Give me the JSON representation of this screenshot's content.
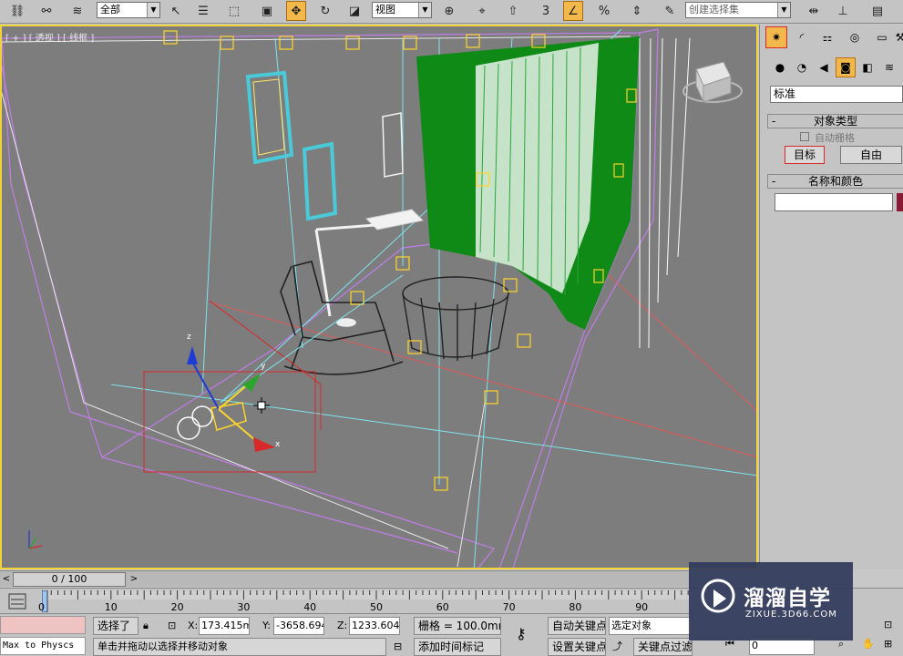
{
  "toolbar": {
    "selection_filter": "全部",
    "reference_coord": "视图",
    "named_selection": "创建选择集",
    "snap_value": "3"
  },
  "viewport": {
    "label": "[ + ] [ 透视 ] [ 线框 ]"
  },
  "command_panel": {
    "category_dropdown": "标准",
    "object_type_title": "对象类型",
    "auto_grid_label": "自动栅格",
    "target_button": "目标",
    "free_button": "自由",
    "name_color_title": "名称和颜色",
    "object_color": "#8a1a34"
  },
  "time_slider": {
    "position_label": "0 / 100",
    "prev": "<",
    "next": ">"
  },
  "track_bar": {
    "ticks": [
      "0",
      "10",
      "20",
      "30",
      "40",
      "50",
      "60",
      "70",
      "80",
      "90"
    ]
  },
  "status_bar": {
    "maxscript_text": "Max to Physcs",
    "selected_label": "选择了",
    "x_label": "X:",
    "x_value": "173.415mr",
    "y_label": "Y:",
    "y_value": "-3658.694",
    "z_label": "Z:",
    "z_value": "1233.604r",
    "grid_label": "栅格 = 100.0mm",
    "prompt_text": "单击并拖动以选择并移动对象",
    "add_time_tag": "添加时间标记",
    "auto_key": "自动关键点",
    "set_key": "设置关键点",
    "key_mode": "选定对象",
    "key_filters": "关键点过滤器...",
    "frame_value": "0"
  },
  "watermark": {
    "title": "溜溜自学",
    "subtitle": "ZIXUE.3D66.COM"
  },
  "colors": {
    "viewport_bg": "#7d7d7d",
    "active_border": "#f2d23a",
    "curtain_green": "#0f8a17",
    "selection_red": "#d8282a",
    "wire_purple": "#9b3fc9",
    "wire_cyan": "#7fe4ec"
  }
}
